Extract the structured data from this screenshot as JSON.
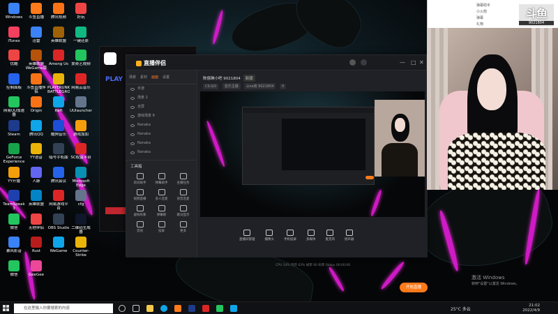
{
  "desktop_icons": [
    {
      "label": "Windows",
      "color": "#3b82f6"
    },
    {
      "label": "斗鱼直播",
      "color": "#ff7a1a"
    },
    {
      "label": "腾讯视频",
      "color": "#f97316"
    },
    {
      "label": "好玩",
      "color": "#ef4444"
    },
    {
      "label": "iTunes",
      "color": "#f43f5e"
    },
    {
      "label": "迅雷",
      "color": "#3b82f6"
    },
    {
      "label": "英雄联盟",
      "color": "#a16207"
    },
    {
      "label": "一键还原",
      "color": "#10b981"
    },
    {
      "label": "优酷",
      "color": "#ef4444"
    },
    {
      "label": "英雄联盟WeGame版",
      "color": "#b45309"
    },
    {
      "label": "Among Us",
      "color": "#dc2626"
    },
    {
      "label": "爱奇艺视频",
      "color": "#22c55e"
    },
    {
      "label": "控制面板",
      "color": "#2563eb"
    },
    {
      "label": "斗鱼直播伴侣",
      "color": "#f97316"
    },
    {
      "label": "PLAYERUNKNOWN'S BATTLEGROUNDS",
      "color": "#eab308"
    },
    {
      "label": "网易云音乐",
      "color": "#dc2626"
    },
    {
      "label": "网易UU加速器",
      "color": "#22c55e"
    },
    {
      "label": "Origin",
      "color": "#f97316"
    },
    {
      "label": "Raft",
      "color": "#0ea5e9"
    },
    {
      "label": "UUlauncher",
      "color": "#64748b"
    },
    {
      "label": "Steam",
      "color": "#1e3a8a"
    },
    {
      "label": "腾讯QQ",
      "color": "#0ea5e9"
    },
    {
      "label": "酷狗音乐",
      "color": "#1d4ed8"
    },
    {
      "label": "游戏加加",
      "color": "#f59e0b"
    },
    {
      "label": "GeForce Experience",
      "color": "#16a34a"
    },
    {
      "label": "YY语音",
      "color": "#eab308"
    },
    {
      "label": "暗号手机版",
      "color": "#334155"
    },
    {
      "label": "SC权益平台",
      "color": "#dc2626"
    },
    {
      "label": "YY开播",
      "color": "#f59e0b"
    },
    {
      "label": "人脉",
      "color": "#6366f1"
    },
    {
      "label": "腾讯会议",
      "color": "#2563eb"
    },
    {
      "label": "Microsoft Edge",
      "color": "#0891b2"
    },
    {
      "label": "TeamSpeak 3",
      "color": "#1e40af"
    },
    {
      "label": "英雄联盟",
      "color": "#0284c7"
    },
    {
      "label": "网易游戏平台",
      "color": "#dc2626"
    },
    {
      "label": "cfg",
      "color": "#64748b"
    },
    {
      "label": "微信",
      "color": "#22c55e"
    },
    {
      "label": "无他伴侣",
      "color": "#ef4444"
    },
    {
      "label": "OBS Studio",
      "color": "#334155"
    },
    {
      "label": "二维码生成器",
      "color": "#0f172a"
    },
    {
      "label": "暴风影音",
      "color": "#3b82f6"
    },
    {
      "label": "Rust",
      "color": "#b91c1c"
    },
    {
      "label": "WeGame",
      "color": "#0ea5e9"
    },
    {
      "label": "Counter-Strike Global",
      "color": "#eab308"
    },
    {
      "label": "微信",
      "color": "#22c55e"
    },
    {
      "label": "GeeGee",
      "color": "#ec4899"
    }
  ],
  "overlay": {
    "brand_big": "斗鱼",
    "brand_small": "DOUYU.COM",
    "room_id": "9021804",
    "top_rows": [
      "弹幕助手",
      "小火箭",
      "弹幕",
      "礼物"
    ]
  },
  "obs_window": {
    "play_label": "PLAY"
  },
  "live_window": {
    "title": "直播伴侣",
    "side_tabs": [
      "场景",
      "素材",
      "画面",
      "设置"
    ],
    "scenes": [
      "手游",
      "场景 2",
      "全屏",
      "游戏场景 8",
      "Nanaka",
      "Nanaka",
      "Nanaka",
      "Nanaka"
    ],
    "tools_title": "工具箱",
    "tools": [
      "房间助手",
      "弹幕助手",
      "主播任务",
      "视频直播",
      "多人连麦",
      "语音连麦",
      "虚拟形象",
      "弹幕姬",
      "歌词显示",
      "音效",
      "投屏",
      "更多"
    ],
    "room_title": "陈僖琳小吧 9021804",
    "room_tag": "新版",
    "meta": [
      "CS:GO",
      "音乐主播",
      "Live房 9021804",
      "0"
    ],
    "bottom_tools": [
      "直播间管理",
      "摄像头",
      "手机投屏",
      "多媒体",
      "麦克风",
      "扬声器"
    ],
    "go_live": "开始直播",
    "status": "CPU 54%   内存 63%   帧率 60   码率 0kbps   00:00:00"
  },
  "taskbar": {
    "search_placeholder": "在这里输入你要搜索的内容",
    "weather": "25°C 多云",
    "time": "21:02",
    "date": "2022/4/9"
  },
  "activate": {
    "line1": "激活 Windows",
    "line2": "转到\"设置\"以激活 Windows。"
  }
}
